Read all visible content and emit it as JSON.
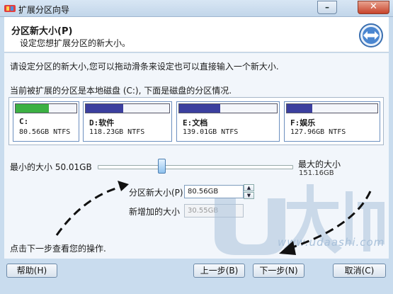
{
  "window": {
    "title": "扩展分区向导"
  },
  "header": {
    "title": "分区新大小(P)",
    "subtitle": "设定您想扩展分区的新大小。"
  },
  "main": {
    "desc1": "请设定分区的新大小,您可以拖动滑条来设定也可以直接输入一个新大小.",
    "desc2": "当前被扩展的分区是本地磁盘 (C:), 下面是磁盘的分区情况.",
    "partitions": [
      {
        "label": "C:",
        "size": "80.56GB NTFS",
        "used_fraction": 0.55,
        "color": "#3cb043"
      },
      {
        "label": "D:软件",
        "size": "118.23GB NTFS",
        "used_fraction": 0.45,
        "color": "#3b3f9e"
      },
      {
        "label": "E:文档",
        "size": "139.01GB NTFS",
        "used_fraction": 0.42,
        "color": "#3b3f9e"
      },
      {
        "label": "F:娱乐",
        "size": "127.96GB NTFS",
        "used_fraction": 0.28,
        "color": "#3b3f9e"
      }
    ],
    "min_label": "最小的大小 50.01GB",
    "max_label": "最大的大小",
    "max_value": "151.16GB",
    "slider_fraction": 0.32,
    "new_size_label": "分区新大小(P)",
    "new_size_value": "80.56GB",
    "added_label": "新增加的大小",
    "added_value": "30.55GB",
    "hint": "点击下一步查看您的操作.",
    "watermark_text": "www.udaashi.com"
  },
  "footer": {
    "help": "帮助(H)",
    "back": "上一步(B)",
    "next": "下一步(N)",
    "cancel": "取消(C)"
  }
}
